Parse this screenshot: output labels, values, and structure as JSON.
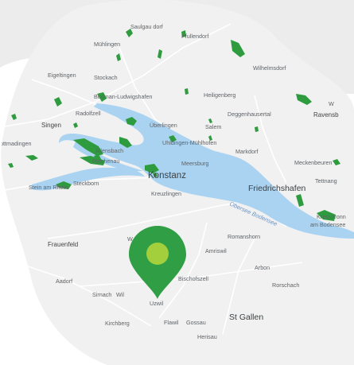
{
  "map": {
    "colors": {
      "page_background": "#ffffff",
      "back_blob": "#ececec",
      "land": "#f1f1f1",
      "water": "#aad3f2",
      "forest": "#2e9b3f",
      "road": "#ffffff",
      "pin_body": "#2f9e44",
      "pin_dot": "#a3cf3c"
    },
    "places": {
      "saulgau_dorf": "Saulgau dorf",
      "muhlingen": "Mühlingen",
      "pfullendorf": "Pfullendorf",
      "eigeltingen": "Eigeltingen",
      "stockach": "Stockach",
      "wilhelmsdorf": "Wilhelmsdorf",
      "bodman": "Bodman-Ludwigshafen",
      "heiligenberg": "Heiligenberg",
      "w_edge": "W",
      "singen": "Singen",
      "radolfzell": "Radolfzell",
      "uberlingen": "Überlingen",
      "salem": "Salem",
      "deggenhausertal": "Deggenhausertal",
      "ravensburg": "Ravensb",
      "gottmadingen": "ottmadingen",
      "allensbach": "Allensbach",
      "uhldingen": "Uhldingen-Mühlhofen",
      "markdorf": "Markdorf",
      "reichenau": "Reichenau",
      "meersburg": "Meersburg",
      "meckenbeuren": "Meckenbeuren",
      "konstanz": "Konstanz",
      "stein_am_rhein": "Stein am Rhein",
      "steckborn": "Steckborn",
      "kreuzlingen": "Kreuzlingen",
      "friedrichshafen": "Friedrichshafen",
      "tettnang": "Tettnang",
      "lake_name": "Obersee Bodensee",
      "kressbronn": "Kressbronn",
      "am_bodensee": "am Bodensee",
      "romanshorn": "Romanshorn",
      "frauenfeld": "Frauenfeld",
      "w_mid": "W",
      "amriswil": "Amriswil",
      "arbon": "Arbon",
      "aadorf": "Aadorf",
      "bischofszell": "Bischofszell",
      "sirnach": "Sirnach",
      "wil": "Wil",
      "rorschach": "Rorschach",
      "uzwil": "Uzwil",
      "kirchberg": "Kirchberg",
      "flawil": "Flawil",
      "gossau": "Gossau",
      "st_gallen": "St Gallen",
      "herisau": "Herisau"
    },
    "marker_icon": "map-pin-icon"
  }
}
